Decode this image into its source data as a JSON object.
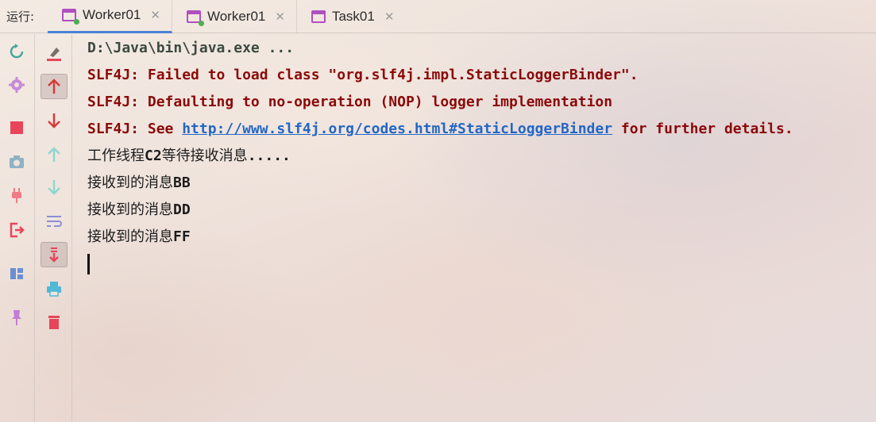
{
  "header": {
    "run_label": "运行:",
    "tabs": [
      {
        "label": "Worker01",
        "active": true,
        "running": true
      },
      {
        "label": "Worker01",
        "active": false,
        "running": true
      },
      {
        "label": "Task01",
        "active": false,
        "running": false
      }
    ],
    "close_glyph": "✕"
  },
  "toolbar_left": [
    "rerun-icon",
    "settings-icon",
    "stop-icon",
    "camera-icon",
    "plug-icon",
    "exit-icon",
    "layout-icon",
    "pin-icon"
  ],
  "toolbar_right": [
    "clear-icon",
    "up-arrow-icon",
    "down-arrow-icon",
    "up-stack-icon",
    "down-stack-icon",
    "soft-wrap-icon",
    "scroll-to-end-icon",
    "print-icon",
    "trash-icon"
  ],
  "colors": {
    "error": "#8b0a0a",
    "link": "#2467c6",
    "accent": "#4a82d8",
    "tab_icon": "#b04fbf"
  },
  "console": {
    "cmd": "D:\\Java\\bin\\java.exe ...",
    "err1": "SLF4J: Failed to load class \"org.slf4j.impl.StaticLoggerBinder\".",
    "err2": "SLF4J: Defaulting to no-operation (NOP) logger implementation",
    "err3_prefix": "SLF4J: See ",
    "err3_link": "http://www.slf4j.org/codes.html#StaticLoggerBinder",
    "err3_suffix": " for further details.",
    "out1_cn1": "工作线程",
    "out1_mid": "C2",
    "out1_cn2": "等待接收消息",
    "out1_tail": ".....",
    "recv_prefix": "接收到的消息",
    "recv1": "BB",
    "recv2": "DD",
    "recv3": "FF"
  }
}
